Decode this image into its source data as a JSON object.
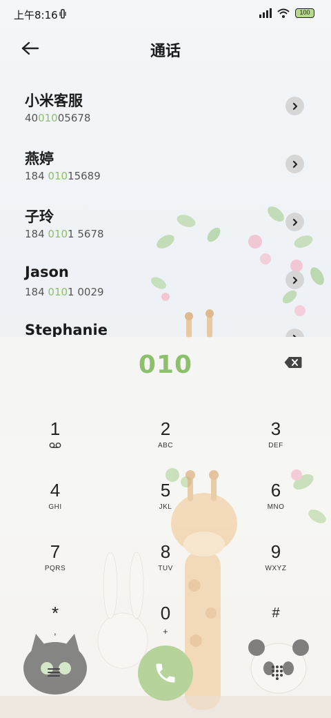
{
  "status_bar": {
    "time": "上午8:16",
    "battery": "100"
  },
  "header": {
    "title": "通话"
  },
  "contacts": [
    {
      "name": "小米客服",
      "number_pre": "40",
      "number_match": "010",
      "number_post": "05678"
    },
    {
      "name": "燕婷",
      "number_pre": "184 ",
      "number_match": "010",
      "number_post": "15689"
    },
    {
      "name": "子玲",
      "number_pre": "184 ",
      "number_match": "010",
      "number_post": "1 5678"
    },
    {
      "name": "Jason",
      "number_pre": "184 ",
      "number_match": "010",
      "number_post": "1 0029"
    },
    {
      "name": "Stephanie",
      "number_pre": "",
      "number_match": "",
      "number_post": ""
    }
  ],
  "dialer": {
    "input": "010",
    "keys": [
      {
        "digit": "1",
        "letters": ""
      },
      {
        "digit": "2",
        "letters": "ABC"
      },
      {
        "digit": "3",
        "letters": "DEF"
      },
      {
        "digit": "4",
        "letters": "GHI"
      },
      {
        "digit": "5",
        "letters": "JKL"
      },
      {
        "digit": "6",
        "letters": "MNO"
      },
      {
        "digit": "7",
        "letters": "PQRS"
      },
      {
        "digit": "8",
        "letters": "TUV"
      },
      {
        "digit": "9",
        "letters": "WXYZ"
      },
      {
        "digit": "*",
        "letters": ","
      },
      {
        "digit": "0",
        "letters": "+"
      },
      {
        "digit": "#",
        "letters": ""
      }
    ]
  },
  "colors": {
    "accent": "#8cc06a",
    "call_button": "#b6d39b"
  },
  "icons": [
    "back-arrow-icon",
    "chevron-right-icon",
    "backspace-icon",
    "voicemail-icon",
    "menu-icon",
    "phone-icon",
    "dialpad-icon"
  ]
}
